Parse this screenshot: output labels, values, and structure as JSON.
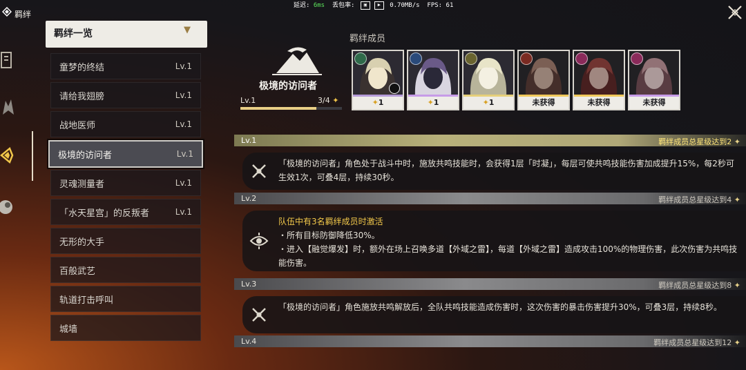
{
  "debug": {
    "latency_label": "延迟:",
    "latency_value": "6ms",
    "loss_label": "丢包率:",
    "speed": "0.70MB/s",
    "fps_label": "FPS:",
    "fps_value": "61"
  },
  "header": {
    "title": "羁绊",
    "close_icon": "close-x-icon"
  },
  "rail": [
    "bond-tab-icon",
    "book-icon",
    "creature-icon",
    "bond-star-icon",
    "sphere-icon"
  ],
  "list": {
    "header": "羁绊一览",
    "items": [
      {
        "name": "童梦的终结",
        "level": "Lv.1"
      },
      {
        "name": "请给我翅膀",
        "level": "Lv.1"
      },
      {
        "name": "战地医师",
        "level": "Lv.1"
      },
      {
        "name": "极境的访问者",
        "level": "Lv.1"
      },
      {
        "name": "灵魂测量者",
        "level": "Lv.1"
      },
      {
        "name": "「水天星宫」的反叛者",
        "level": "Lv.1"
      },
      {
        "name": "无形的大手",
        "level": ""
      },
      {
        "name": "百般武艺",
        "level": ""
      },
      {
        "name": "轨道打击呼叫",
        "level": ""
      },
      {
        "name": "城墙",
        "level": ""
      }
    ],
    "active_index": 3
  },
  "bond": {
    "name": "极境的访问者",
    "level": "Lv.1",
    "progress_text": "3/4",
    "progress_fraction": 0.75,
    "star": "✦"
  },
  "members": {
    "title": "羁绊成员",
    "cards": [
      {
        "element": "wind-element-icon",
        "elem_color": "#2f6a4a",
        "status": "1",
        "strip": "#b59bd8",
        "palette": [
          "#d8d0b0",
          "#3a3230",
          "#f0e6cc"
        ],
        "obtained": true,
        "clock": true
      },
      {
        "element": "ice-element-icon",
        "elem_color": "#2a4a7a",
        "status": "1",
        "strip": "#c79be8",
        "palette": [
          "#6a5a88",
          "#d9d5e0",
          "#2a2838"
        ],
        "obtained": true,
        "clock": false
      },
      {
        "element": "light-element-icon",
        "elem_color": "#6a6430",
        "status": "1",
        "strip": "#e6d07a",
        "palette": [
          "#e8e4c8",
          "#b8b49a",
          "#f4f0e2"
        ],
        "obtained": true,
        "clock": false
      },
      {
        "element": "fire-element-icon",
        "elem_color": "#7a2a22",
        "status": "未获得",
        "strip": "#f0c85a",
        "palette": [
          "#b87a62",
          "#6a3a30",
          "#d8a890"
        ],
        "obtained": false,
        "clock": false
      },
      {
        "element": "spiral-element-icon",
        "elem_color": "#8a2a5a",
        "status": "未获得",
        "strip": "#f0c85a",
        "palette": [
          "#c23a34",
          "#7a2222",
          "#e8b0a0"
        ],
        "obtained": false,
        "clock": false
      },
      {
        "element": "spiral-element-icon",
        "elem_color": "#8a2a5a",
        "status": "未获得",
        "strip": "#c79be8",
        "palette": [
          "#d8909a",
          "#8a4a58",
          "#f0c8c8"
        ],
        "obtained": false,
        "clock": false
      }
    ]
  },
  "levels": [
    {
      "label": "Lv.1",
      "requirement": "羁绊成员总星级达到2",
      "active": true,
      "lines": [
        "「极境的访问者」角色处于战斗中时，施放共鸣技能时，会获得1层「时凝」，每层可使共鸣技能伤害加成提升15%，每2秒可生效1次，可叠4层，持续30秒。"
      ],
      "icon": "crossed-swords-icon"
    },
    {
      "label": "Lv.2",
      "requirement": "羁绊成员总星级达到4",
      "active": false,
      "highlight": "队伍中有3名羁绊成员时激活",
      "lines": [
        "・所有目标防御降低30%。",
        "・进入【融觉爆发】时，额外在场上召唤多道【外域之雷】，每道【外域之雷】造成攻击100%的物理伤害，此次伤害为共鸣技能伤害。"
      ],
      "icon": "eye-sigil-icon"
    },
    {
      "label": "Lv.3",
      "requirement": "羁绊成员总星级达到8",
      "active": false,
      "lines": [
        "「极境的访问者」角色施放共鸣解放后，全队共鸣技能造成伤害时，这次伤害的暴击伤害提升30%，可叠3层，持续8秒。"
      ],
      "icon": "crossed-swords-icon"
    },
    {
      "label": "Lv.4",
      "requirement": "羁绊成员总星级达到12",
      "active": false,
      "lines": [],
      "icon": ""
    }
  ]
}
